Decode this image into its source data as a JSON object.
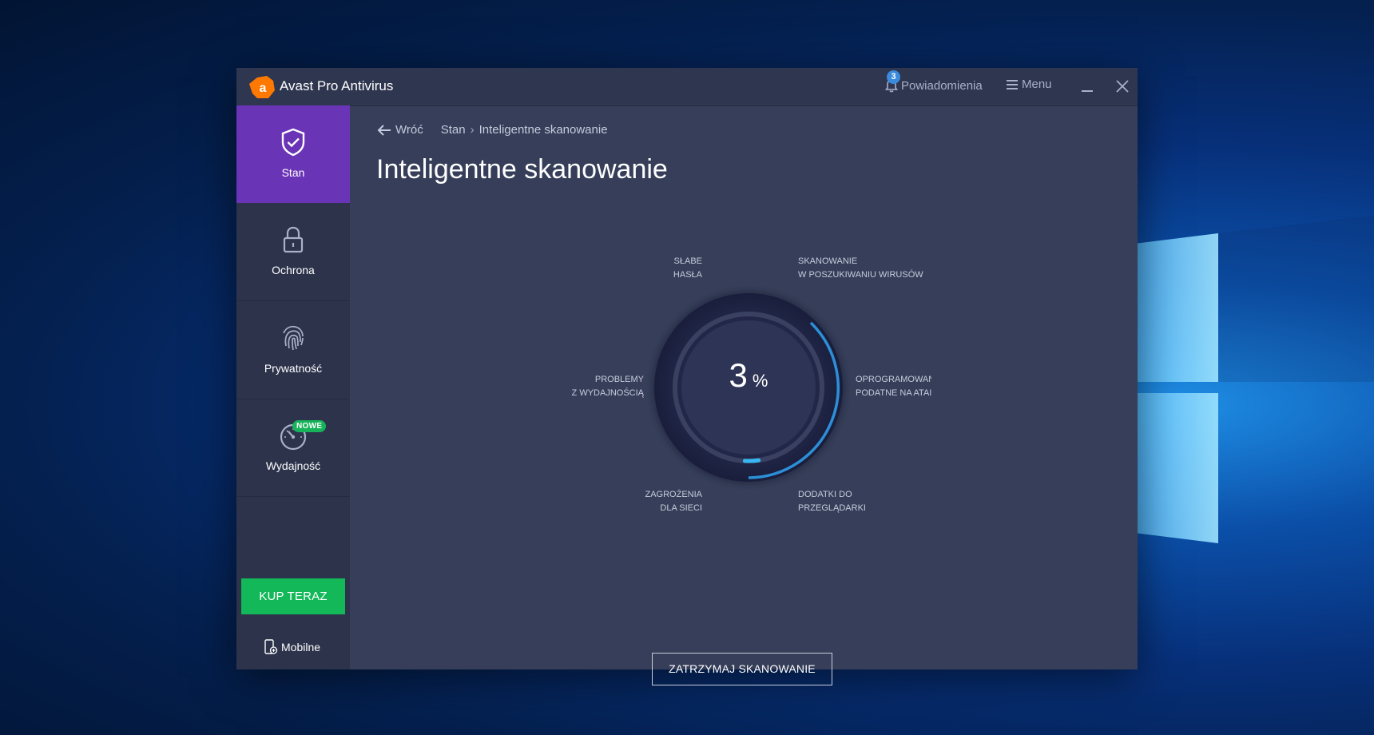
{
  "app": {
    "title": "Avast Pro Antivirus",
    "brand_color": "#ff7800",
    "notifications_label": "Powiadomienia",
    "notifications_count": "3",
    "menu_label": "Menu"
  },
  "sidebar": {
    "items": [
      {
        "label": "Stan",
        "icon": "shield-check-icon",
        "active": true
      },
      {
        "label": "Ochrona",
        "icon": "lock-icon",
        "active": false
      },
      {
        "label": "Prywatność",
        "icon": "fingerprint-icon",
        "active": false
      },
      {
        "label": "Wydajność",
        "icon": "speedometer-icon",
        "active": false,
        "badge": "NOWE"
      }
    ],
    "buy_label": "KUP TERAZ",
    "mobile_label": "Mobilne",
    "active_color": "#6a34b6",
    "buy_color": "#13b858"
  },
  "main": {
    "back_label": "Wróć",
    "breadcrumb": [
      "Stan",
      "Inteligentne skanowanie"
    ],
    "title": "Inteligentne skanowanie",
    "progress_value": "3",
    "progress_unit": "%",
    "progress_fraction": 0.03,
    "scan_steps": {
      "weak_passwords": [
        "SŁABE",
        "HASŁA"
      ],
      "virus_scan": [
        "SKANOWANIE",
        "W POSZUKIWANIU WIRUSÓW"
      ],
      "vulnerable_software": [
        "OPROGRAMOWAN",
        "PODATNE NA ATAI"
      ],
      "browser_addons": [
        "DODATKI DO",
        "PRZEGLĄDARKI"
      ],
      "network_threats": [
        "ZAGROŻENIA",
        "DLA SIECI"
      ],
      "performance_issues": [
        "PROBLEMY",
        "Z WYDAJNOŚCIĄ"
      ]
    },
    "stop_label": "ZATRZYMAJ SKANOWANIE",
    "accent_color": "#2f9be8"
  }
}
